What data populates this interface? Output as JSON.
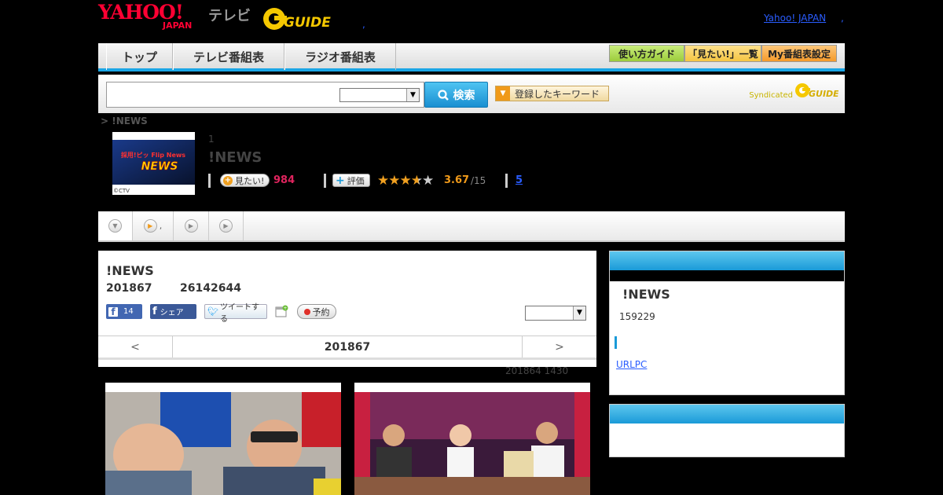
{
  "header": {
    "yahoo_logo": "YAHOO!",
    "japan_logo": "JAPAN",
    "tv_label": "テレビ",
    "gguide_logo": "GUIDE",
    "dot": ",",
    "yahoo_japan_link": "Yahoo! JAPAN",
    "yahoo_japan_dot": ","
  },
  "nav": {
    "tabs": [
      {
        "label": "トップ"
      },
      {
        "label": "テレビ番組表"
      },
      {
        "label": "ラジオ番組表"
      }
    ],
    "util_buttons": [
      {
        "label": "使い方ガイド",
        "color": "#9ccc3c"
      },
      {
        "label": "「見たい!」一覧",
        "color": "#f5c542"
      },
      {
        "label": "My番組表設定",
        "color": "#f59a2a"
      }
    ]
  },
  "search": {
    "input_value": "",
    "select_value": "",
    "button_label": "検索",
    "keyword_button": "登録したキーワード",
    "syndicated_label": "Syndicated",
    "syndicated_logo": "GUIDE"
  },
  "breadcrumb": "> !NEWS",
  "program": {
    "thumb_text": "NEWS",
    "thumb_sub": "採用!ピッ Flip News",
    "thumb_copyright": "©CTV",
    "number": "1",
    "title": "!NEWS",
    "mitai_label": "見たい!",
    "mitai_count": "984",
    "rate_label": "評価",
    "stars": "★★★★★",
    "rating": "3.67",
    "rating_of": "/15",
    "reviews": "5"
  },
  "tabbar": {
    "tab2_text": ","
  },
  "main": {
    "title": "!NEWS",
    "date": "201867",
    "id": "26142644",
    "fb_like_count": "14",
    "fb_share_label": "シェア",
    "tweet_label": "ツイートする",
    "reserve_label": "予約",
    "select_value": "",
    "pager_prev": "<",
    "pager_current": "201867",
    "pager_next": ">",
    "note": "201864  1430"
  },
  "side1": {
    "title": "!NEWS",
    "number": "159229",
    "link": "URLPC"
  },
  "colors": {
    "accent": "#1aa6e6",
    "mitai": "#e0245e",
    "rating": "#f09a1a",
    "link": "#2a5dff"
  }
}
